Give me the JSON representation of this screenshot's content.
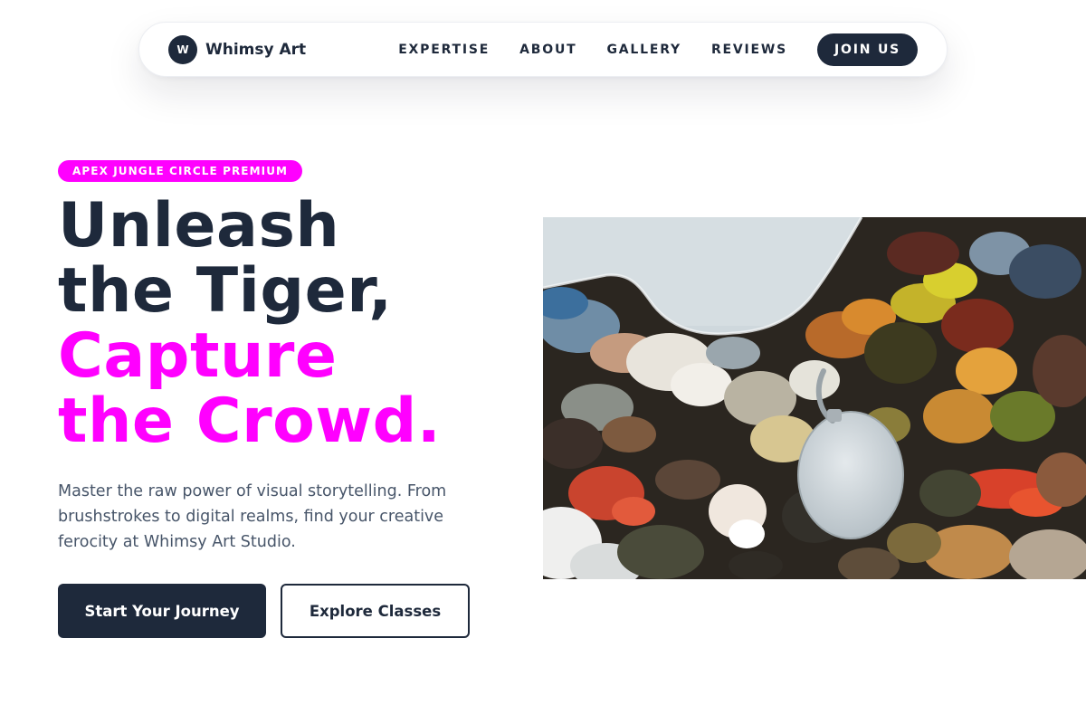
{
  "nav": {
    "brand_initial": "W",
    "brand_name": "Whimsy Art",
    "links": [
      {
        "label": "EXPERTISE"
      },
      {
        "label": "ABOUT"
      },
      {
        "label": "GALLERY"
      },
      {
        "label": "REVIEWS"
      }
    ],
    "cta_label": "JOIN US"
  },
  "hero": {
    "badge": "APEX JUNGLE CIRCLE PREMIUM",
    "headline_lines": [
      "Unleash",
      "the Tiger,",
      "Capture",
      "the Crowd."
    ],
    "description": "Master the raw power of visual storytelling. From brushstrokes to digital realms, find your creative ferocity at Whimsy Art Studio.",
    "primary_cta": "Start Your Journey",
    "secondary_cta": "Explore Classes",
    "image_subject": "paint-palette-photo"
  },
  "colors": {
    "navy": "#1e293b",
    "magenta": "#ff00ff",
    "body_text": "#475569",
    "background": "#ffffff"
  }
}
